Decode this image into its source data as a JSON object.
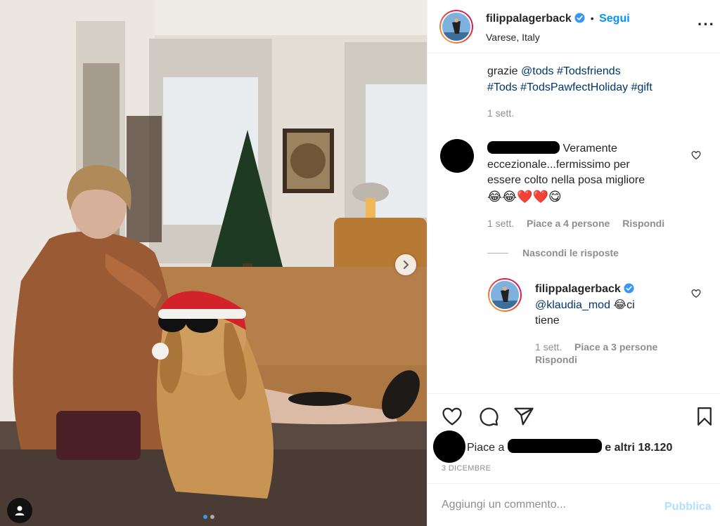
{
  "post": {
    "username": "filippalagerback",
    "verified": true,
    "follow_label": "Segui",
    "separator": "•",
    "location": "Varese, Italy"
  },
  "caption": {
    "line1_prefix": "grazie",
    "line1_mention": "@tods",
    "line1_tag": "#Todsfriends",
    "line2_tag1": "#Tods",
    "line2_tag2": "#TodsPawfectHoliday",
    "line2_tag3": "#gift",
    "time": "1 sett."
  },
  "comment1": {
    "text_line1_suffix": "Veramente",
    "text_line2": "eccezionale...fermissimo per",
    "text_line3": "essere colto nella posa migliore",
    "emojis": "😂😂❤️❤️😋",
    "time": "1 sett.",
    "likes": "Piace a 4 persone",
    "reply_label": "Rispondi"
  },
  "hide_replies_label": "Nascondi le risposte",
  "reply1": {
    "username": "filippalagerback",
    "mention": "@klaudia_mod",
    "emoji": "😂",
    "text_a": "ci",
    "text_b": "tiene",
    "time": "1 sett.",
    "likes": "Piace a 3 persone",
    "reply_label": "Rispondi"
  },
  "likes_bar": {
    "prefix": "Piace a",
    "suffix": "e altri 18.120"
  },
  "post_date": "3 DICEMBRE",
  "add_comment": {
    "placeholder": "Aggiungi un commento...",
    "publish_label": "Pubblica"
  },
  "colors": {
    "accent": "#0095f6",
    "text": "#262626",
    "muted": "#8e8e8e",
    "publish_disabled": "#b2dffc"
  },
  "icons": {
    "more": "more-options-icon",
    "like": "heart-icon",
    "comment": "comment-icon",
    "share": "share-icon",
    "save": "bookmark-icon",
    "next": "chevron-right-icon",
    "tag": "user-tag-icon"
  },
  "carousel": {
    "current": 1,
    "total": 2
  }
}
